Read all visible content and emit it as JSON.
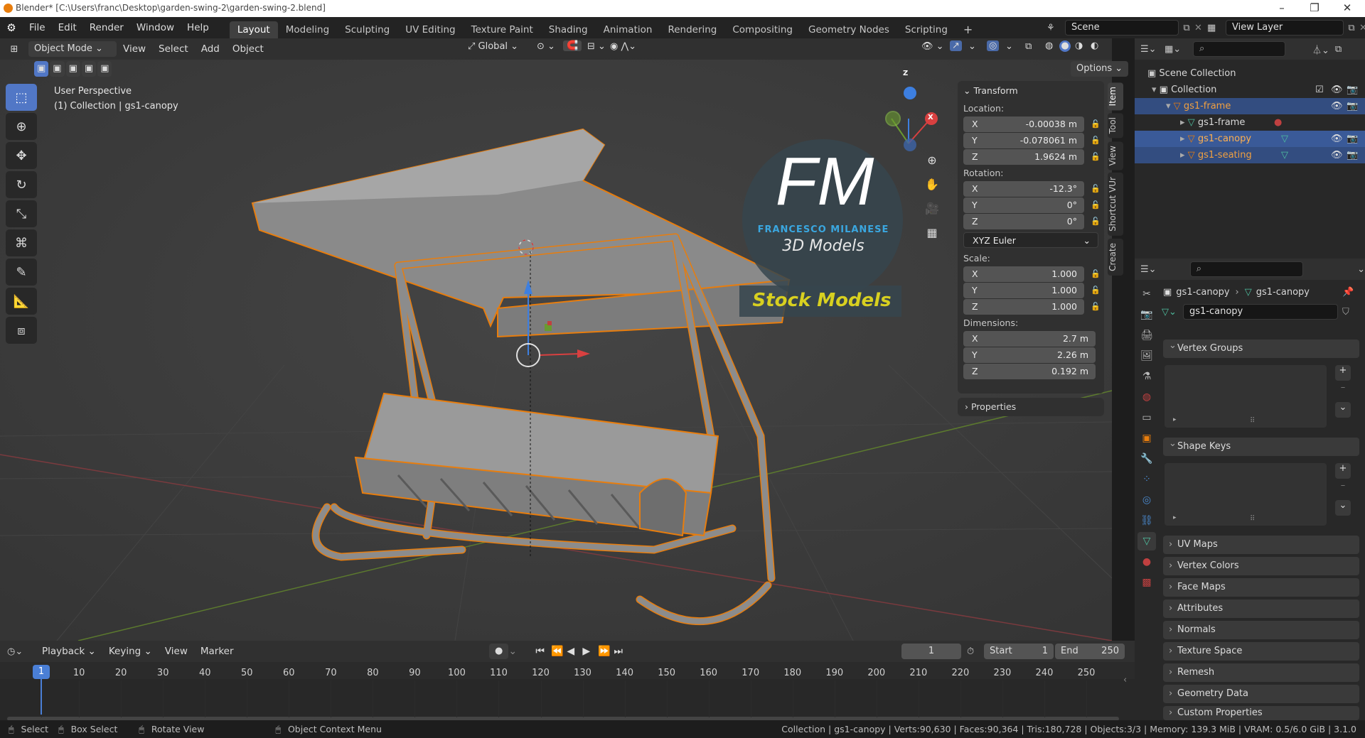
{
  "window": {
    "title": "Blender* [C:\\Users\\franc\\Desktop\\garden-swing-2\\garden-swing-2.blend]"
  },
  "menu": {
    "items": [
      "File",
      "Edit",
      "Render",
      "Window",
      "Help"
    ]
  },
  "workspaces": {
    "tabs": [
      "Layout",
      "Modeling",
      "Sculpting",
      "UV Editing",
      "Texture Paint",
      "Shading",
      "Animation",
      "Rendering",
      "Compositing",
      "Geometry Nodes",
      "Scripting"
    ],
    "add": "+"
  },
  "scene": {
    "name": "Scene",
    "view_layer": "View Layer"
  },
  "viewport": {
    "mode": "Object Mode",
    "menus": [
      "View",
      "Select",
      "Add",
      "Object"
    ],
    "transform_orientation": "Global",
    "options": "Options",
    "perspective": "User Perspective",
    "collection_info": "(1) Collection | gs1-canopy",
    "gizmo": {
      "x": "X",
      "y": "Y",
      "z": "Z"
    }
  },
  "watermark": {
    "initials": "FM",
    "name": "FRANCESCO MILANESE",
    "sub": "3D Models",
    "stock": "Stock Models"
  },
  "npanel": {
    "section": "Transform",
    "location_label": "Location:",
    "location": [
      {
        "axis": "X",
        "value": "-0.00038 m"
      },
      {
        "axis": "Y",
        "value": "-0.078061 m"
      },
      {
        "axis": "Z",
        "value": "1.9624 m"
      }
    ],
    "rotation_label": "Rotation:",
    "rotation": [
      {
        "axis": "X",
        "value": "-12.3°"
      },
      {
        "axis": "Y",
        "value": "0°"
      },
      {
        "axis": "Z",
        "value": "0°"
      }
    ],
    "rotation_mode": "XYZ Euler",
    "scale_label": "Scale:",
    "scale": [
      {
        "axis": "X",
        "value": "1.000"
      },
      {
        "axis": "Y",
        "value": "1.000"
      },
      {
        "axis": "Z",
        "value": "1.000"
      }
    ],
    "dimensions_label": "Dimensions:",
    "dimensions": [
      {
        "axis": "X",
        "value": "2.7 m"
      },
      {
        "axis": "Y",
        "value": "2.26 m"
      },
      {
        "axis": "Z",
        "value": "0.192 m"
      }
    ],
    "properties": "Properties",
    "tabs": [
      "Item",
      "Tool",
      "View",
      "Shortcut VUr",
      "Create"
    ]
  },
  "outliner": {
    "scene_collection": "Scene Collection",
    "collection": "Collection",
    "items": [
      {
        "name": "gs1-frame",
        "level": 2
      },
      {
        "name": "gs1-frame",
        "level": 3
      },
      {
        "name": "gs1-canopy",
        "level": 3
      },
      {
        "name": "gs1-seating",
        "level": 3
      }
    ]
  },
  "properties": {
    "breadcrumb_object": "gs1-canopy",
    "breadcrumb_mesh": "gs1-canopy",
    "datablock": "gs1-canopy",
    "sections": [
      "Vertex Groups",
      "Shape Keys",
      "UV Maps",
      "Vertex Colors",
      "Face Maps",
      "Attributes",
      "Normals",
      "Texture Space",
      "Remesh",
      "Geometry Data",
      "Custom Properties"
    ]
  },
  "timeline": {
    "menus": [
      "Playback",
      "Keying",
      "View",
      "Marker"
    ],
    "current_frame": "1",
    "start_label": "Start",
    "start": "1",
    "end_label": "End",
    "end": "250",
    "ticks": [
      "1",
      "10",
      "20",
      "30",
      "40",
      "50",
      "60",
      "70",
      "80",
      "90",
      "100",
      "110",
      "120",
      "130",
      "140",
      "150",
      "160",
      "170",
      "180",
      "190",
      "200",
      "210",
      "220",
      "230",
      "240",
      "250"
    ]
  },
  "status": {
    "select": "Select",
    "box_select": "Box Select",
    "rotate_view": "Rotate View",
    "context_menu": "Object Context Menu",
    "stats": "Collection | gs1-canopy | Verts:90,630 | Faces:90,364 | Tris:180,728 | Objects:3/3 | Memory: 139.3 MiB | VRAM: 0.5/6.0 GiB | 3.1.0"
  },
  "colors": {
    "accent": "#5177c6",
    "selection": "#e87d0d",
    "outliner_selected": "#334d80"
  }
}
